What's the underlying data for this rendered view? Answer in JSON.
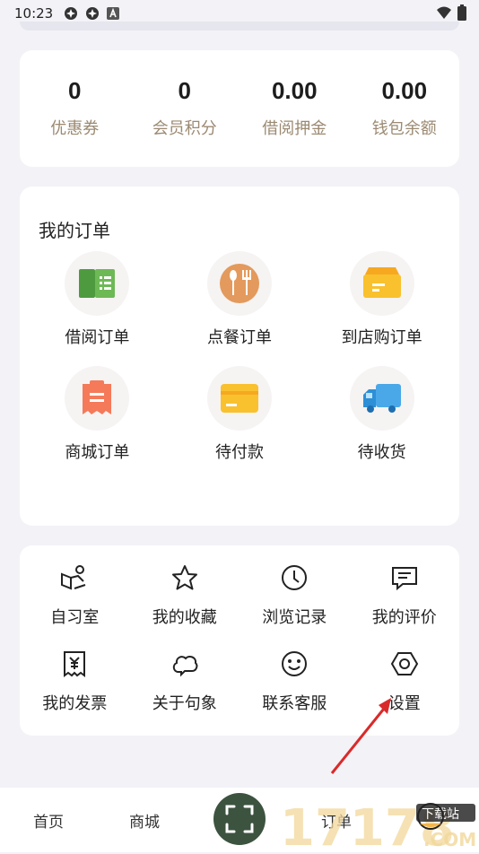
{
  "status": {
    "time": "10:23"
  },
  "stats": [
    {
      "value": "0",
      "label": "优惠券"
    },
    {
      "value": "0",
      "label": "会员积分"
    },
    {
      "value": "0.00",
      "label": "借阅押金"
    },
    {
      "value": "0.00",
      "label": "钱包余额"
    }
  ],
  "orders": {
    "title": "我的订单",
    "items": [
      {
        "label": "借阅订单",
        "icon": "book-icon"
      },
      {
        "label": "点餐订单",
        "icon": "dining-icon"
      },
      {
        "label": "到店购订单",
        "icon": "box-icon"
      },
      {
        "label": "商城订单",
        "icon": "receipt-icon"
      },
      {
        "label": "待付款",
        "icon": "card-icon"
      },
      {
        "label": "待收货",
        "icon": "truck-icon"
      }
    ]
  },
  "tools": [
    {
      "label": "自习室",
      "icon": "study-room-icon"
    },
    {
      "label": "我的收藏",
      "icon": "star-icon"
    },
    {
      "label": "浏览记录",
      "icon": "clock-icon"
    },
    {
      "label": "我的评价",
      "icon": "comment-icon"
    },
    {
      "label": "我的发票",
      "icon": "invoice-icon"
    },
    {
      "label": "关于句象",
      "icon": "cloud-icon"
    },
    {
      "label": "联系客服",
      "icon": "smile-icon"
    },
    {
      "label": "设置",
      "icon": "hexagon-settings-icon"
    }
  ],
  "tabbar": {
    "home": "首页",
    "mall": "商城",
    "orders": "订单"
  },
  "watermark": {
    "number": "17178",
    "site": "下载站",
    "domain": ".COM"
  },
  "colors": {
    "accent": "#3c5340",
    "label_gold": "#9b8a72"
  }
}
